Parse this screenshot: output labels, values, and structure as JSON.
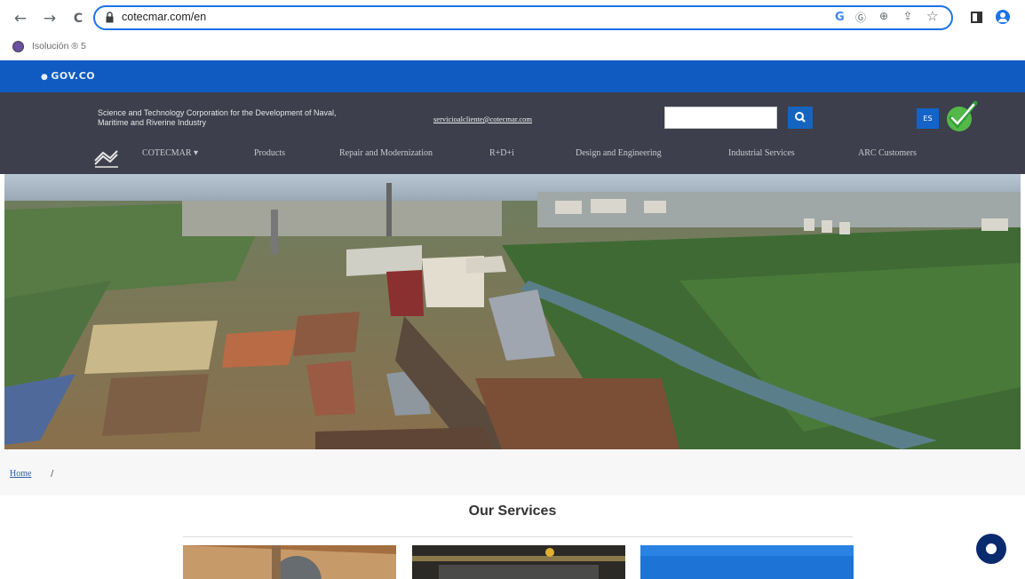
{
  "browser": {
    "url": "cotecmar.com/en",
    "bookmark_label": "Isolución ® 5",
    "icons": [
      "back-icon",
      "forward-icon",
      "reload-icon",
      "lock-icon",
      "google-icon",
      "translate-icon",
      "zoom-icon",
      "share-icon",
      "star-icon",
      "sidepanel-icon",
      "profile-icon"
    ],
    "nav_glyphs": {
      "back": "←",
      "forward": "→",
      "reload": "C"
    },
    "toolbar_glyphs": {
      "translate": "Ⓖ",
      "star": "☆",
      "zoom": "⊕",
      "share": "⇪"
    },
    "accent": "#1a73e8"
  },
  "gov_bar": {
    "logo": "GOV.CO",
    "color": "#0f5bc2"
  },
  "header": {
    "tagline": "Science and Technology Corporation for the Development of Naval, Maritime and Riverine Industry",
    "email": "servicioalcliente@cotecmar.com",
    "language_button": "ES",
    "background": "#3d3f4c",
    "nav": {
      "cotecmar": "COTECMAR ▾",
      "products": "Products",
      "repair": "Repair and Modernization",
      "rdi": "R+D+i",
      "design": "Design and Engineering",
      "industrial": "Industrial Services",
      "arc": "ARC Customers"
    }
  },
  "breadcrumb": {
    "home": "Home",
    "separator": "/"
  },
  "services": {
    "title": "Our Services"
  }
}
